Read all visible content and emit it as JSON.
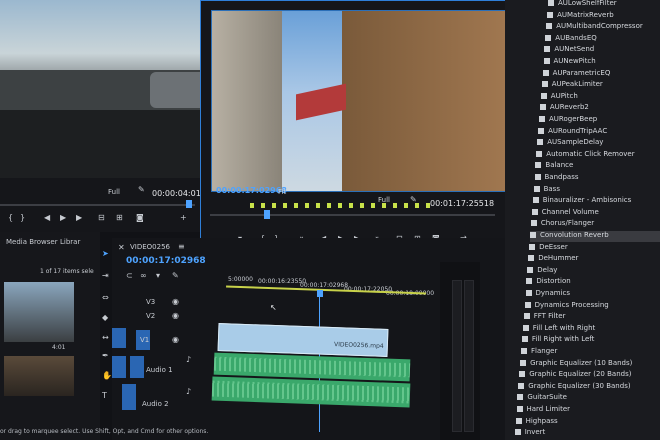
{
  "source_monitor": {
    "fit": "Full",
    "timecode": "00:00:04:01"
  },
  "program_monitor": {
    "timecode_left": "00:00:17:02968",
    "fit": "Fit",
    "fit2": "Full",
    "timecode_right": "00:01:17:25518"
  },
  "project_panel": {
    "tab_media_browser": "Media Browser",
    "tab_libraries": "Librar",
    "count": "1 of 17 items sele",
    "clip_duration": "4:01"
  },
  "timeline": {
    "title": "VIDEO0256",
    "timecode": "00:00:17:02968",
    "ruler": [
      "5:00000",
      "00:00:16:23550",
      "00:00:17:02968",
      "00:00:17:22050",
      "00:00:18:00000"
    ],
    "tracks": [
      {
        "id": "V3",
        "label": ""
      },
      {
        "id": "V2",
        "label": ""
      },
      {
        "id": "V1",
        "label": ""
      },
      {
        "id": "A1",
        "label": "Audio 1"
      },
      {
        "id": "A2",
        "label": "Audio 2"
      }
    ],
    "clip_name": "VIDEO0256.mp4"
  },
  "status_text": "or drag to marquee select. Use Shift, Opt, and Cmd for other options.",
  "effects_list": [
    "AULowShelfFilter",
    "AUMatrixReverb",
    "AUMultibandCompressor",
    "AUBandsEQ",
    "AUNetSend",
    "AUNewPitch",
    "AUParametricEQ",
    "AUPeakLimiter",
    "AUPitch",
    "AUReverb2",
    "AURogerBeep",
    "AURoundTripAAC",
    "AUSampleDelay",
    "Automatic Click Remover",
    "Balance",
    "Bandpass",
    "Bass",
    "Binauralizer - Ambisonics",
    "Channel Volume",
    "Chorus/Flanger",
    "Convolution Reverb",
    "DeEsser",
    "DeHummer",
    "Delay",
    "Distortion",
    "Dynamics",
    "Dynamics Processing",
    "FFT Filter",
    "Fill Left with Right",
    "Fill Right with Left",
    "Flanger",
    "Graphic Equalizer (10 Bands)",
    "Graphic Equalizer (20 Bands)",
    "Graphic Equalizer (30 Bands)",
    "GuitarSuite",
    "Hard Limiter",
    "Highpass",
    "Invert"
  ],
  "effects_selected": "Convolution Reverb",
  "colors": {
    "accent": "#2f7fd8",
    "playhead": "#4ea3ff",
    "video_clip": "#a9cce8",
    "audio_clip": "#3aa86b"
  }
}
